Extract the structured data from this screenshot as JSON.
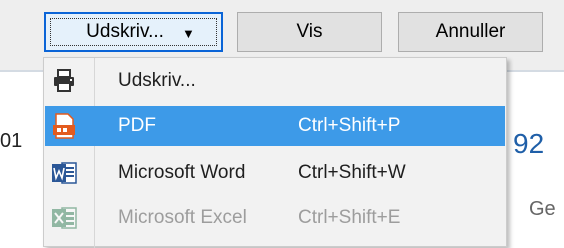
{
  "toolbar": {
    "print_button_label": "Udskriv...",
    "view_button_label": "Vis",
    "cancel_button_label": "Annuller"
  },
  "menu": {
    "items": [
      {
        "label": "Udskriv...",
        "shortcut": "",
        "icon": "printer-icon",
        "state": "normal"
      },
      {
        "label": "PDF",
        "shortcut": "Ctrl+Shift+P",
        "icon": "pdf-icon",
        "state": "selected"
      },
      {
        "label": "Microsoft Word",
        "shortcut": "Ctrl+Shift+W",
        "icon": "word-icon",
        "state": "normal"
      },
      {
        "label": "Microsoft Excel",
        "shortcut": "Ctrl+Shift+E",
        "icon": "excel-icon",
        "state": "disabled"
      }
    ]
  },
  "background": {
    "left_fragment": "01",
    "right_number": "92",
    "right_fragment": "Ge"
  },
  "colors": {
    "selection": "#3d9ae8",
    "focus_border": "#0a64d7",
    "pdf_orange": "#e35b1e",
    "word_blue": "#2b5797",
    "excel_green": "#1e7145"
  }
}
